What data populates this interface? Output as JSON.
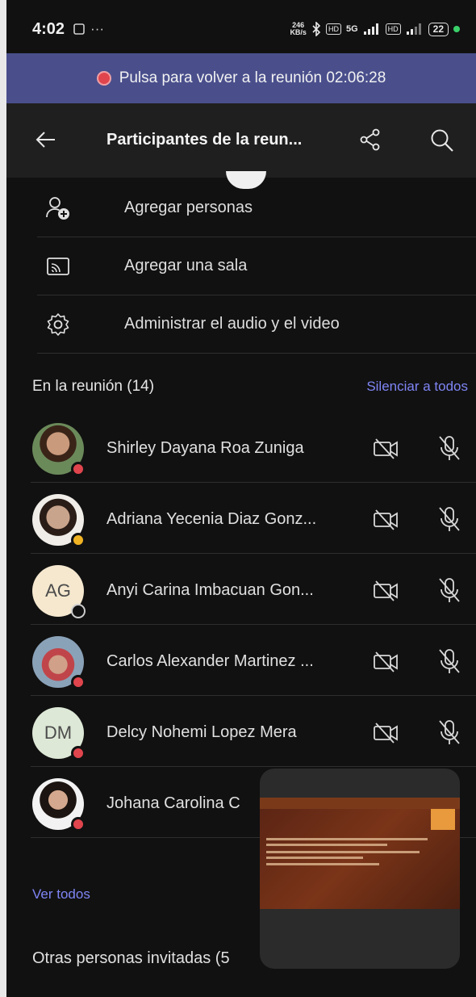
{
  "status_bar": {
    "time": "4:02",
    "extra": "···",
    "net_speed_top": "246",
    "net_speed_bottom": "KB/s",
    "net_5g": "5G",
    "battery": "22"
  },
  "banner": {
    "text": "Pulsa para volver a la reunión 02:06:28"
  },
  "header": {
    "title": "Participantes de la reun..."
  },
  "actions": [
    {
      "label": "Agregar personas",
      "icon": "add-person-icon"
    },
    {
      "label": "Agregar una sala",
      "icon": "cast-room-icon"
    },
    {
      "label": "Administrar el audio y el video",
      "icon": "gear-icon"
    }
  ],
  "section": {
    "title": "En la reunión (14)",
    "mute_all": "Silenciar a todos"
  },
  "participants": [
    {
      "name": "Shirley Dayana Roa Zuniga",
      "avatar": "photo",
      "presence": "busy",
      "presence_color": "#e0454d"
    },
    {
      "name": "Adriana Yecenia Diaz Gonz...",
      "avatar": "photo",
      "presence": "away",
      "presence_color": "#f0b323"
    },
    {
      "name": "Anyi Carina Imbacuan Gon...",
      "avatar": "initials",
      "initials": "AG",
      "presence": "offline",
      "presence_color": "#111111"
    },
    {
      "name": "Carlos Alexander Martinez ...",
      "avatar": "photo",
      "presence": "busy",
      "presence_color": "#e0454d"
    },
    {
      "name": "Delcy Nohemi Lopez Mera",
      "avatar": "initials",
      "initials": "DM",
      "presence": "busy",
      "presence_color": "#e0454d"
    },
    {
      "name": "Johana Carolina C",
      "avatar": "photo",
      "presence": "busy",
      "presence_color": "#e0454d"
    }
  ],
  "see_all": "Ver todos",
  "others": "Otras personas invitadas (5",
  "colors": {
    "banner": "#4a4f8c",
    "accent": "#7f85f5",
    "background": "#111111"
  }
}
